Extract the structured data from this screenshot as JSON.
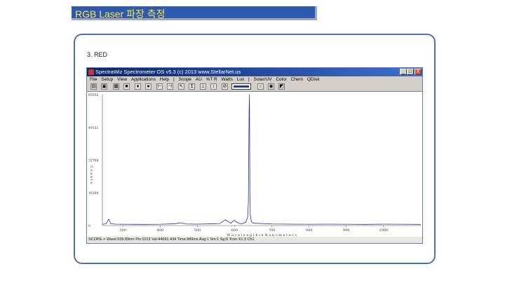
{
  "slide": {
    "title": "RGB Laser 파장 측정",
    "section": "3. RED"
  },
  "window": {
    "title": "SpectraWiz  Spectrometer OS v5.3 (c) 2013    www.StellarNet.us",
    "buttons": [
      "_",
      "□",
      "X"
    ]
  },
  "menu": [
    "File",
    "Setup",
    "View",
    "Applications",
    "Help",
    "|",
    "Scope",
    "AU",
    "%T R",
    "Watts",
    "Lux",
    "|",
    "Solar/UV",
    "Color",
    "Chem",
    "QDisk"
  ],
  "toolbar": {
    "icons": [
      "open-icon",
      "save-icon",
      "print-icon",
      "camera-icon",
      "lamp-icon",
      "bulb-icon",
      "cursor-icon",
      "peak-icon",
      "zoom-icon",
      "rescale-icon",
      "baseline-icon",
      "autoscale-icon",
      "dark-icon",
      "integration-field",
      "stop-icon",
      "color-icon",
      "graph-icon"
    ]
  },
  "chart_data": {
    "type": "line",
    "xlabel": "W a v e l e n g t h   i n   N a n o m e t e r s",
    "ylabel": "C o u n t s",
    "xlim": [
      245,
      1100
    ],
    "ylim": [
      0,
      65535
    ],
    "x_ticks": [
      300,
      400,
      500,
      600,
      700,
      800,
      900,
      1000
    ],
    "y_ticks": [
      0,
      16384,
      32768,
      49151,
      65535
    ],
    "series": [
      {
        "x": [
          245,
          255,
          262,
          268,
          280,
          300,
          350,
          400,
          440,
          455,
          470,
          500,
          540,
          560,
          575,
          590,
          598,
          605,
          612,
          620,
          630,
          635,
          637,
          638,
          639,
          639.89,
          640.5,
          641,
          642,
          645,
          650,
          700,
          750,
          800,
          850,
          900,
          950,
          1000,
          1050,
          1100
        ],
        "y": [
          600,
          900,
          3200,
          900,
          700,
          650,
          600,
          650,
          900,
          1400,
          800,
          700,
          900,
          1000,
          2900,
          1200,
          2600,
          1800,
          1100,
          900,
          1600,
          4200,
          12000,
          38000,
          58000,
          65535,
          40000,
          15000,
          5500,
          2000,
          1200,
          800,
          700,
          650,
          700,
          650,
          600,
          700,
          650,
          600
        ]
      }
    ]
  },
  "status": "SCOPE-> Wave:639.89nm Pix:1013 Val:44691.434 Time:989ms Avg:1 Sm:1 Sg:0 Tcon X1:3 Ch1"
}
